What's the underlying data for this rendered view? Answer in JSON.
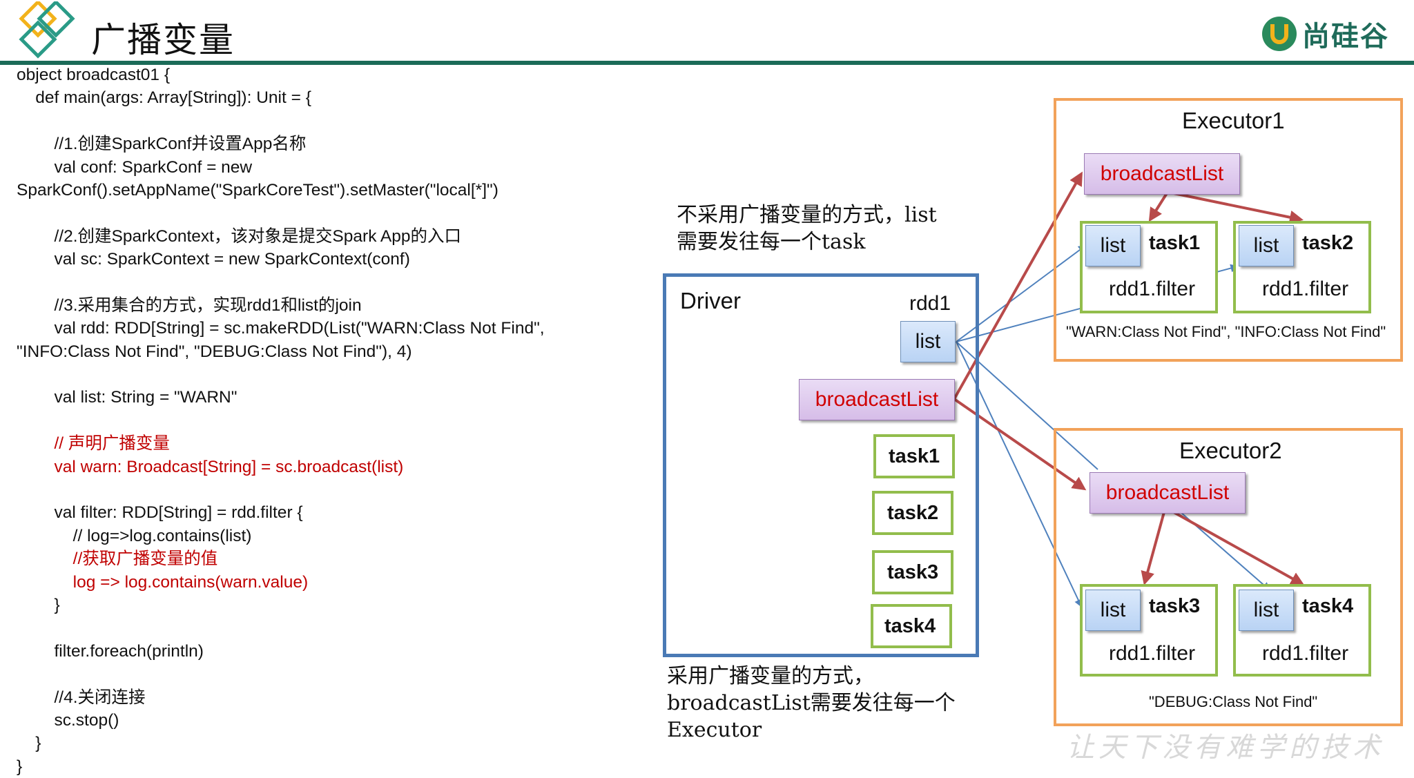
{
  "header": {
    "title": "广播变量",
    "brand_name": "尚硅谷",
    "colors": {
      "rule": "#1b6b58",
      "logo_yellow": "#f2b21b",
      "logo_teal": "#2a9b87"
    }
  },
  "code": {
    "lines": [
      {
        "text": "object broadcast01 {",
        "style": "normal"
      },
      {
        "text": "    def main(args: Array[String]): Unit = {",
        "style": "normal"
      },
      {
        "text": "",
        "style": "normal"
      },
      {
        "text": "        //1.创建SparkConf并设置App名称",
        "style": "normal"
      },
      {
        "text": "        val conf: SparkConf = new",
        "style": "normal"
      },
      {
        "text": "SparkConf().setAppName(\"SparkCoreTest\").setMaster(\"local[*]\")",
        "style": "normal"
      },
      {
        "text": "",
        "style": "normal"
      },
      {
        "text": "        //2.创建SparkContext，该对象是提交Spark App的入口",
        "style": "normal"
      },
      {
        "text": "        val sc: SparkContext = new SparkContext(conf)",
        "style": "normal"
      },
      {
        "text": "",
        "style": "normal"
      },
      {
        "text": "        //3.采用集合的方式，实现rdd1和list的join",
        "style": "normal"
      },
      {
        "text": "        val rdd: RDD[String] = sc.makeRDD(List(\"WARN:Class Not Find\",",
        "style": "normal"
      },
      {
        "text": "\"INFO:Class Not Find\", \"DEBUG:Class Not Find\"), 4)",
        "style": "normal"
      },
      {
        "text": "",
        "style": "normal"
      },
      {
        "text": "        val list: String = \"WARN\"",
        "style": "normal"
      },
      {
        "text": "",
        "style": "normal"
      },
      {
        "text": "        // 声明广播变量",
        "style": "red"
      },
      {
        "text": "        val warn: Broadcast[String] = sc.broadcast(list)",
        "style": "red"
      },
      {
        "text": "",
        "style": "normal"
      },
      {
        "text": "        val filter: RDD[String] = rdd.filter {",
        "style": "normal"
      },
      {
        "text": "            // log=>log.contains(list)",
        "style": "normal"
      },
      {
        "text": "            //获取广播变量的值",
        "style": "red"
      },
      {
        "text": "            log => log.contains(warn.value)",
        "style": "red"
      },
      {
        "text": "        }",
        "style": "normal"
      },
      {
        "text": "",
        "style": "normal"
      },
      {
        "text": "        filter.foreach(println)",
        "style": "normal"
      },
      {
        "text": "",
        "style": "normal"
      },
      {
        "text": "        //4.关闭连接",
        "style": "normal"
      },
      {
        "text": "        sc.stop()",
        "style": "normal"
      },
      {
        "text": "    }",
        "style": "normal"
      },
      {
        "text": "}",
        "style": "normal"
      }
    ]
  },
  "diagram": {
    "note_top": "不采用广播变量的方式，list\n需要发往每一个task",
    "note_bottom": "采用广播变量的方式，\nbroadcastList需要发往每一个\nExecutor",
    "driver": {
      "title": "Driver",
      "rdd_label": "rdd1",
      "list_label": "list",
      "broadcast_label": "broadcastList",
      "tasks": [
        "task1",
        "task2",
        "task3",
        "task4"
      ]
    },
    "executor1": {
      "title": "Executor1",
      "broadcast_label": "broadcastList",
      "tasks": [
        {
          "list": "list",
          "task": "task1",
          "op": "rdd1.filter"
        },
        {
          "list": "list",
          "task": "task2",
          "op": "rdd1.filter"
        }
      ],
      "data_label": "\"WARN:Class Not Find\", \"INFO:Class Not Find\""
    },
    "executor2": {
      "title": "Executor2",
      "broadcast_label": "broadcastList",
      "tasks": [
        {
          "list": "list",
          "task": "task3",
          "op": "rdd1.filter"
        },
        {
          "list": "list",
          "task": "task4",
          "op": "rdd1.filter"
        }
      ],
      "data_label": "\"DEBUG:Class Not Find\""
    },
    "colors": {
      "driver_border": "#4a7ab5",
      "executor_border": "#f2a25a",
      "task_border": "#92bd4c",
      "broadcast_text": "#d00000",
      "arrow_red": "#b84a4a",
      "arrow_blue": "#4f81bd"
    }
  },
  "footer": {
    "slogan": "让天下没有难学的技术"
  }
}
